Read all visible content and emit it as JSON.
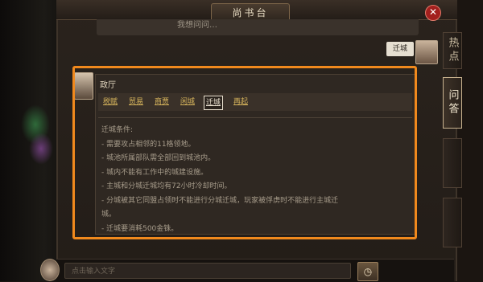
{
  "header": {
    "title": "尚书台",
    "close_label": "✕"
  },
  "prev_message": {
    "text": "我想问问…"
  },
  "user_message": {
    "text": "迁城"
  },
  "side_tabs": {
    "hot": "热点",
    "ask": "问答",
    "ghost1": "",
    "ghost2": ""
  },
  "answer": {
    "title": "政厅",
    "tabs": [
      {
        "label": "税赋",
        "active": false
      },
      {
        "label": "贸易",
        "active": false
      },
      {
        "label": "商贾",
        "active": false
      },
      {
        "label": "闲城",
        "active": false
      },
      {
        "label": "迁城",
        "active": true
      },
      {
        "label": "再起",
        "active": false
      }
    ],
    "lines": [
      "迁城条件:",
      "- 需要攻占相邻的11格领地。",
      "- 城池所属部队需全部回到城池内。",
      "- 城内不能有工作中的城建设施。",
      "- 主城和分城迁城均有72小时冷却时间。",
      "- 分城被其它同盟占领时不能进行分城迁城，玩家被俘虏时不能进行主城迁",
      "城。",
      "- 迁城要消耗500金铢。"
    ]
  },
  "input": {
    "placeholder": "点击输入文字"
  },
  "icons": {
    "clock": "clock-icon",
    "close": "close-icon"
  },
  "colors": {
    "highlight": "#f0891d",
    "close": "#a3201e",
    "active_tab_text": "#e9e0cf",
    "tab_text": "#d6b45c"
  }
}
